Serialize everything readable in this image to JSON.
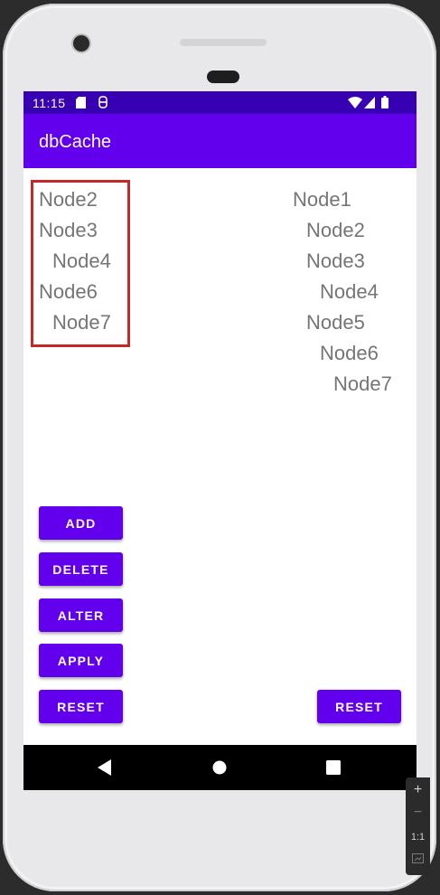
{
  "statusbar": {
    "time": "11:15"
  },
  "appbar": {
    "title": "dbCache"
  },
  "left_list": {
    "items": [
      {
        "label": "Node2",
        "level": 0
      },
      {
        "label": "Node3",
        "level": 0
      },
      {
        "label": "Node4",
        "level": 1
      },
      {
        "label": "Node6",
        "level": 0
      },
      {
        "label": "Node7",
        "level": 1
      }
    ]
  },
  "right_list": {
    "items": [
      {
        "label": "Node1",
        "level": 0
      },
      {
        "label": "Node2",
        "level": 1
      },
      {
        "label": "Node3",
        "level": 1
      },
      {
        "label": "Node4",
        "level": 2
      },
      {
        "label": "Node5",
        "level": 1
      },
      {
        "label": "Node6",
        "level": 2
      },
      {
        "label": "Node7",
        "level": 3
      }
    ]
  },
  "buttons": {
    "add": "ADD",
    "delete": "DELETE",
    "alter": "ALTER",
    "apply": "APPLY",
    "reset_left": "RESET",
    "reset_right": "RESET"
  },
  "emulator_zoom": {
    "plus": "+",
    "minus": "−",
    "one_to_one": "1:1"
  },
  "colors": {
    "statusbar": "#3700b3",
    "appbar": "#6200ee",
    "button": "#6200ee",
    "node_text": "#757575",
    "highlight": "#c62828"
  },
  "icons": [
    "sd-card-icon",
    "sync-icon",
    "wifi-icon",
    "signal-icon",
    "battery-icon",
    "back-icon",
    "home-icon",
    "recents-icon"
  ]
}
